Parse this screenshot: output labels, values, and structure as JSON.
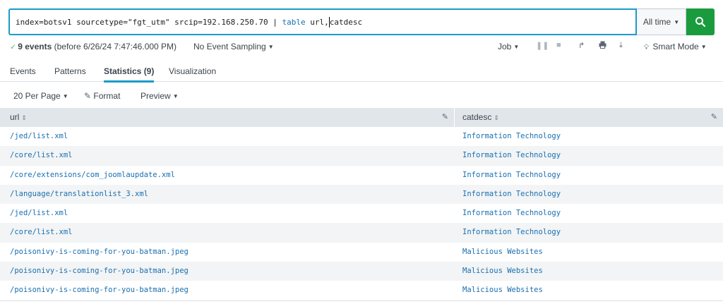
{
  "search": {
    "query_part1": "index=botsv1 sourcetype=\"fgt_utm\" srcip=192.168.250.70 | ",
    "query_kw": "table",
    "query_part2": " url,",
    "query_part3": "catdesc",
    "time_range": "All time"
  },
  "status": {
    "event_count": "9 events",
    "event_suffix": "(before 6/26/24 7:47:46.000 PM)",
    "sampling": "No Event Sampling",
    "job": "Job",
    "mode": "Smart Mode"
  },
  "tabs": [
    {
      "label": "Events"
    },
    {
      "label": "Patterns"
    },
    {
      "label": "Statistics (9)",
      "active": true
    },
    {
      "label": "Visualization"
    }
  ],
  "toolbar": {
    "per_page": "20 Per Page",
    "format": "Format",
    "preview": "Preview"
  },
  "table": {
    "columns": [
      "url",
      "catdesc"
    ],
    "rows": [
      [
        "/jed/list.xml",
        "Information Technology"
      ],
      [
        "/core/list.xml",
        "Information Technology"
      ],
      [
        "/core/extensions/com_joomlaupdate.xml",
        "Information Technology"
      ],
      [
        "/language/translationlist_3.xml",
        "Information Technology"
      ],
      [
        "/jed/list.xml",
        "Information Technology"
      ],
      [
        "/core/list.xml",
        "Information Technology"
      ],
      [
        "/poisonivy-is-coming-for-you-batman.jpeg",
        "Malicious Websites"
      ],
      [
        "/poisonivy-is-coming-for-you-batman.jpeg",
        "Malicious Websites"
      ],
      [
        "/poisonivy-is-coming-for-you-batman.jpeg",
        "Malicious Websites"
      ]
    ]
  },
  "colors": {
    "accent": "#1a9cc8",
    "search_button": "#1a9c3e",
    "link": "#1a6fb0"
  },
  "icons": [
    "search-icon",
    "check-icon",
    "pause-icon",
    "stop-icon",
    "share-icon",
    "print-icon",
    "export-icon",
    "bulb-icon",
    "pencil-icon",
    "sort-icon",
    "caret-down-icon"
  ]
}
